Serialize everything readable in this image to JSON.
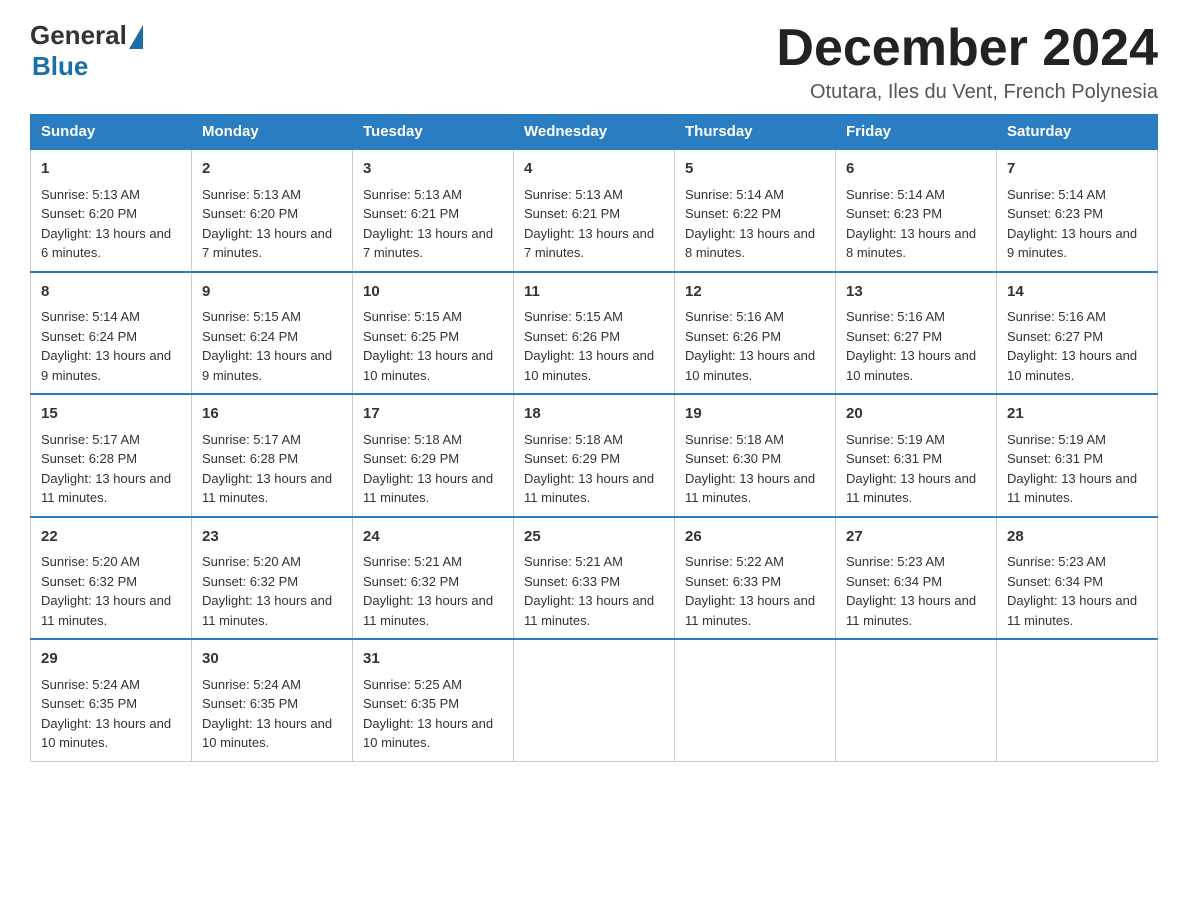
{
  "logo": {
    "general": "General",
    "blue": "Blue"
  },
  "title": "December 2024",
  "subtitle": "Otutara, Iles du Vent, French Polynesia",
  "days_of_week": [
    "Sunday",
    "Monday",
    "Tuesday",
    "Wednesday",
    "Thursday",
    "Friday",
    "Saturday"
  ],
  "weeks": [
    [
      {
        "day": "1",
        "sunrise": "5:13 AM",
        "sunset": "6:20 PM",
        "daylight": "13 hours and 6 minutes."
      },
      {
        "day": "2",
        "sunrise": "5:13 AM",
        "sunset": "6:20 PM",
        "daylight": "13 hours and 7 minutes."
      },
      {
        "day": "3",
        "sunrise": "5:13 AM",
        "sunset": "6:21 PM",
        "daylight": "13 hours and 7 minutes."
      },
      {
        "day": "4",
        "sunrise": "5:13 AM",
        "sunset": "6:21 PM",
        "daylight": "13 hours and 7 minutes."
      },
      {
        "day": "5",
        "sunrise": "5:14 AM",
        "sunset": "6:22 PM",
        "daylight": "13 hours and 8 minutes."
      },
      {
        "day": "6",
        "sunrise": "5:14 AM",
        "sunset": "6:23 PM",
        "daylight": "13 hours and 8 minutes."
      },
      {
        "day": "7",
        "sunrise": "5:14 AM",
        "sunset": "6:23 PM",
        "daylight": "13 hours and 9 minutes."
      }
    ],
    [
      {
        "day": "8",
        "sunrise": "5:14 AM",
        "sunset": "6:24 PM",
        "daylight": "13 hours and 9 minutes."
      },
      {
        "day": "9",
        "sunrise": "5:15 AM",
        "sunset": "6:24 PM",
        "daylight": "13 hours and 9 minutes."
      },
      {
        "day": "10",
        "sunrise": "5:15 AM",
        "sunset": "6:25 PM",
        "daylight": "13 hours and 10 minutes."
      },
      {
        "day": "11",
        "sunrise": "5:15 AM",
        "sunset": "6:26 PM",
        "daylight": "13 hours and 10 minutes."
      },
      {
        "day": "12",
        "sunrise": "5:16 AM",
        "sunset": "6:26 PM",
        "daylight": "13 hours and 10 minutes."
      },
      {
        "day": "13",
        "sunrise": "5:16 AM",
        "sunset": "6:27 PM",
        "daylight": "13 hours and 10 minutes."
      },
      {
        "day": "14",
        "sunrise": "5:16 AM",
        "sunset": "6:27 PM",
        "daylight": "13 hours and 10 minutes."
      }
    ],
    [
      {
        "day": "15",
        "sunrise": "5:17 AM",
        "sunset": "6:28 PM",
        "daylight": "13 hours and 11 minutes."
      },
      {
        "day": "16",
        "sunrise": "5:17 AM",
        "sunset": "6:28 PM",
        "daylight": "13 hours and 11 minutes."
      },
      {
        "day": "17",
        "sunrise": "5:18 AM",
        "sunset": "6:29 PM",
        "daylight": "13 hours and 11 minutes."
      },
      {
        "day": "18",
        "sunrise": "5:18 AM",
        "sunset": "6:29 PM",
        "daylight": "13 hours and 11 minutes."
      },
      {
        "day": "19",
        "sunrise": "5:18 AM",
        "sunset": "6:30 PM",
        "daylight": "13 hours and 11 minutes."
      },
      {
        "day": "20",
        "sunrise": "5:19 AM",
        "sunset": "6:31 PM",
        "daylight": "13 hours and 11 minutes."
      },
      {
        "day": "21",
        "sunrise": "5:19 AM",
        "sunset": "6:31 PM",
        "daylight": "13 hours and 11 minutes."
      }
    ],
    [
      {
        "day": "22",
        "sunrise": "5:20 AM",
        "sunset": "6:32 PM",
        "daylight": "13 hours and 11 minutes."
      },
      {
        "day": "23",
        "sunrise": "5:20 AM",
        "sunset": "6:32 PM",
        "daylight": "13 hours and 11 minutes."
      },
      {
        "day": "24",
        "sunrise": "5:21 AM",
        "sunset": "6:32 PM",
        "daylight": "13 hours and 11 minutes."
      },
      {
        "day": "25",
        "sunrise": "5:21 AM",
        "sunset": "6:33 PM",
        "daylight": "13 hours and 11 minutes."
      },
      {
        "day": "26",
        "sunrise": "5:22 AM",
        "sunset": "6:33 PM",
        "daylight": "13 hours and 11 minutes."
      },
      {
        "day": "27",
        "sunrise": "5:23 AM",
        "sunset": "6:34 PM",
        "daylight": "13 hours and 11 minutes."
      },
      {
        "day": "28",
        "sunrise": "5:23 AM",
        "sunset": "6:34 PM",
        "daylight": "13 hours and 11 minutes."
      }
    ],
    [
      {
        "day": "29",
        "sunrise": "5:24 AM",
        "sunset": "6:35 PM",
        "daylight": "13 hours and 10 minutes."
      },
      {
        "day": "30",
        "sunrise": "5:24 AM",
        "sunset": "6:35 PM",
        "daylight": "13 hours and 10 minutes."
      },
      {
        "day": "31",
        "sunrise": "5:25 AM",
        "sunset": "6:35 PM",
        "daylight": "13 hours and 10 minutes."
      },
      null,
      null,
      null,
      null
    ]
  ]
}
